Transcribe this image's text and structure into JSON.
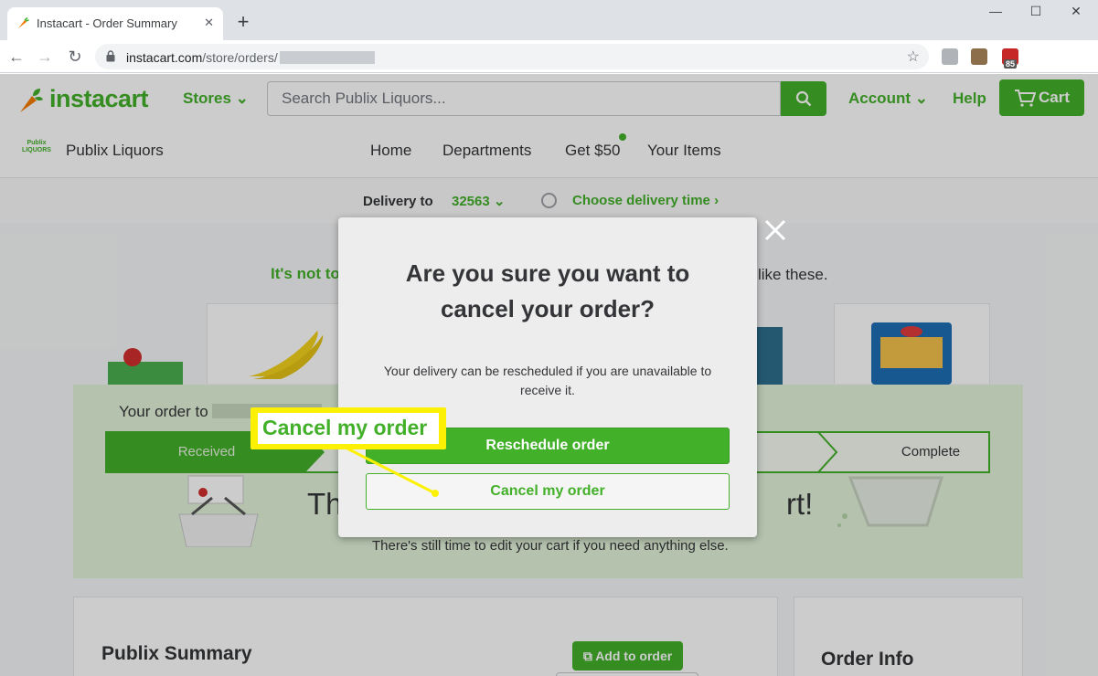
{
  "browser": {
    "tab_title": "Instacart - Order Summary",
    "url_host": "instacart.com",
    "url_path": "/store/orders/",
    "extension_badge": "85"
  },
  "header": {
    "logo_text": "instacart",
    "stores_label": "Stores",
    "search_placeholder": "Search Publix Liquors...",
    "account_label": "Account",
    "help_label": "Help",
    "cart_label": "Cart"
  },
  "store": {
    "logo_text": "Publix LIQUORS",
    "name": "Publix Liquors",
    "nav": [
      "Home",
      "Departments",
      "Get $50",
      "Your Items"
    ]
  },
  "delivery": {
    "label": "Delivery to",
    "zip": "32563",
    "time_label": "Choose delivery time"
  },
  "notice": {
    "left": "It's not to",
    "right": "like these."
  },
  "order_status": {
    "order_to": "Your order to",
    "steps": {
      "received": "Received",
      "complete": "Complete"
    },
    "big_text_left": "Th",
    "big_text_right": "rt!",
    "edit_note": "There's still time to edit your cart if you need anything else."
  },
  "summary": {
    "title": "Publix Summary",
    "add_to_order": "Add to order"
  },
  "info": {
    "title": "Order Info"
  },
  "modal": {
    "title": "Are you sure you want to cancel your order?",
    "body": "Your delivery can be rescheduled if you are unavailable to receive it.",
    "reschedule_label": "Reschedule order",
    "cancel_label": "Cancel my order"
  },
  "callout": {
    "text": "Cancel my order"
  },
  "colors": {
    "brand_green": "#43b02a",
    "callout_yellow": "#fcf104"
  }
}
